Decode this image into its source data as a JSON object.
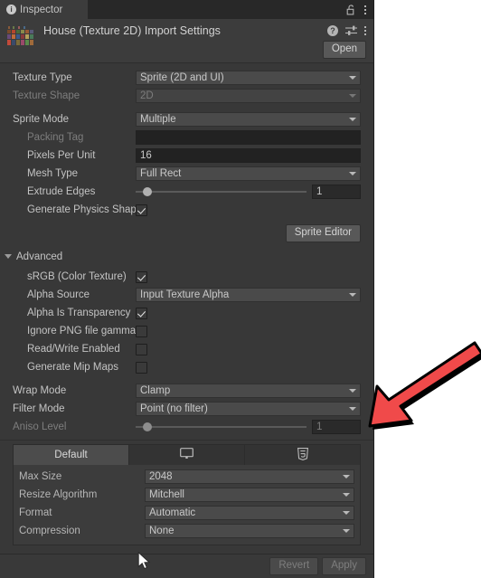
{
  "window": {
    "tab_label": "Inspector",
    "tab_icon": "info-icon",
    "lock_icon": "padlock-open-icon",
    "menu_icon": "kebab-menu-icon"
  },
  "header": {
    "title": "House (Texture 2D) Import Settings",
    "thumbnail_icon": "texture-thumbnail",
    "help_icon": "help-icon",
    "preset_icon": "preset-icon",
    "menu_icon": "kebab-menu-icon",
    "open_label": "Open"
  },
  "texture": {
    "texture_type": {
      "label": "Texture Type",
      "value": "Sprite (2D and UI)"
    },
    "texture_shape": {
      "label": "Texture Shape",
      "value": "2D",
      "disabled": true
    },
    "sprite_mode": {
      "label": "Sprite Mode",
      "value": "Multiple"
    },
    "packing_tag": {
      "label": "Packing Tag",
      "value": "",
      "placeholder": ""
    },
    "pixels_per_unit": {
      "label": "Pixels Per Unit",
      "value": "16"
    },
    "mesh_type": {
      "label": "Mesh Type",
      "value": "Full Rect"
    },
    "extrude_edges": {
      "label": "Extrude Edges",
      "value": "1",
      "slider_pct": 7
    },
    "generate_physics_shape": {
      "label": "Generate Physics Shape",
      "checked": true
    },
    "sprite_editor_label": "Sprite Editor"
  },
  "advanced": {
    "title": "Advanced",
    "srgb": {
      "label": "sRGB (Color Texture)",
      "checked": true
    },
    "alpha_source": {
      "label": "Alpha Source",
      "value": "Input Texture Alpha"
    },
    "alpha_is_transparency": {
      "label": "Alpha Is Transparency",
      "checked": true
    },
    "ignore_png_gamma": {
      "label": "Ignore PNG file gamma",
      "checked": false
    },
    "read_write_enabled": {
      "label": "Read/Write Enabled",
      "checked": false
    },
    "generate_mip_maps": {
      "label": "Generate Mip Maps",
      "checked": false
    }
  },
  "filtering": {
    "wrap_mode": {
      "label": "Wrap Mode",
      "value": "Clamp"
    },
    "filter_mode": {
      "label": "Filter Mode",
      "value": "Point (no filter)"
    },
    "aniso_level": {
      "label": "Aniso Level",
      "value": "1",
      "slider_pct": 7,
      "disabled": true
    }
  },
  "platform": {
    "tabs": [
      {
        "label": "Default",
        "icon": "",
        "active": true
      },
      {
        "label": "",
        "icon": "monitor-icon",
        "active": false
      },
      {
        "label": "",
        "icon": "webgl-html5-icon",
        "active": false
      }
    ],
    "max_size": {
      "label": "Max Size",
      "value": "2048"
    },
    "resize_algorithm": {
      "label": "Resize Algorithm",
      "value": "Mitchell"
    },
    "format": {
      "label": "Format",
      "value": "Automatic"
    },
    "compression": {
      "label": "Compression",
      "value": "None"
    }
  },
  "footer": {
    "revert_label": "Revert",
    "apply_label": "Apply"
  },
  "annotation": {
    "arrow_icon": "red-arrow-pointing-down-left",
    "arrow_color": "#f04a4a",
    "arrow_shadow_color": "#000000",
    "cursor_icon": "mouse-pointer-arrow"
  },
  "colors": {
    "panel_bg": "#383838",
    "header_bg": "#3c3c3c",
    "tabstrip_bg": "#282828",
    "popup_bg": "#4a4a4a",
    "text": "#c4c4c4",
    "text_dim": "#7d7d7d",
    "outside_bg": "#ffffff"
  }
}
